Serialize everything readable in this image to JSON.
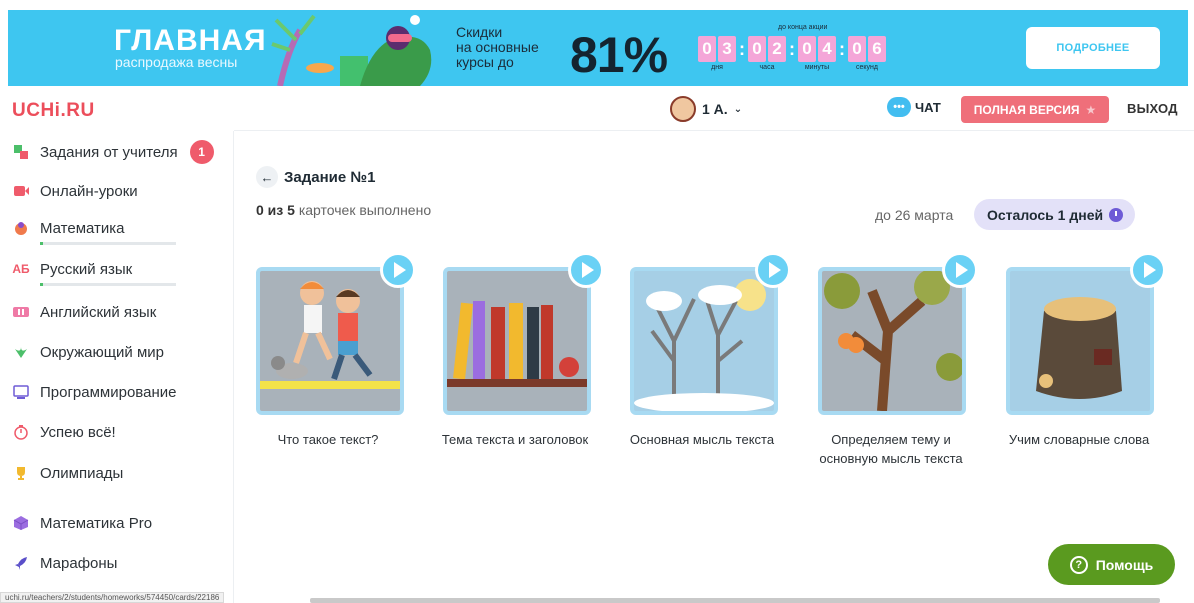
{
  "banner": {
    "title": "ГЛАВНАЯ",
    "subtitle": "распродажа весны",
    "description_lines": [
      "Скидки",
      "на основные",
      "курсы до"
    ],
    "discount": "81%",
    "timer_caption": "до конца акции",
    "timer": [
      {
        "digits": [
          "0",
          "3"
        ],
        "label": "дня"
      },
      {
        "digits": [
          "0",
          "2"
        ],
        "label": "часа"
      },
      {
        "digits": [
          "0",
          "4"
        ],
        "label": "минуты"
      },
      {
        "digits": [
          "0",
          "6"
        ],
        "label": "секунд"
      }
    ],
    "button": "ПОДРОБНЕЕ"
  },
  "header": {
    "logo": "UCHi.RU",
    "user": "1 А.",
    "chat": "ЧАТ",
    "full_version": "ПОЛНАЯ ВЕРСИЯ",
    "logout": "ВЫХОД"
  },
  "sidebar": {
    "items": [
      {
        "label": "Задания от учителя",
        "icon": "tasks-icon",
        "badge": "1"
      },
      {
        "label": "Онлайн-уроки",
        "icon": "video-icon"
      },
      {
        "label": "Математика",
        "icon": "math-icon",
        "progress": 0.02
      },
      {
        "label": "Русский язык",
        "icon": "russian-icon",
        "progress": 0.02
      },
      {
        "label": "Английский язык",
        "icon": "english-icon"
      },
      {
        "label": "Окружающий мир",
        "icon": "world-icon"
      },
      {
        "label": "Программирование",
        "icon": "programming-icon"
      },
      {
        "label": "Успею всё!",
        "icon": "timer-icon"
      },
      {
        "label": "Олимпиады",
        "icon": "trophy-icon"
      },
      {
        "label": "Математика Pro",
        "icon": "cube-icon"
      },
      {
        "label": "Марафоны",
        "icon": "rocket-icon"
      }
    ]
  },
  "assignment": {
    "title": "Задание №1",
    "progress_done": "0 из 5",
    "progress_text": "карточек выполнено",
    "deadline": "до 26 марта",
    "remaining": "Осталось 1 дней",
    "cards": [
      {
        "title": "Что такое текст?"
      },
      {
        "title": "Тема текста и заголовок"
      },
      {
        "title": "Основная мысль текста"
      },
      {
        "title": "Определяем тему и основную мысль текста"
      },
      {
        "title": "Учим словарные слова"
      }
    ]
  },
  "help": "Помощь",
  "status_url": "uchi.ru/teachers/2/students/homeworks/574450/cards/22186"
}
